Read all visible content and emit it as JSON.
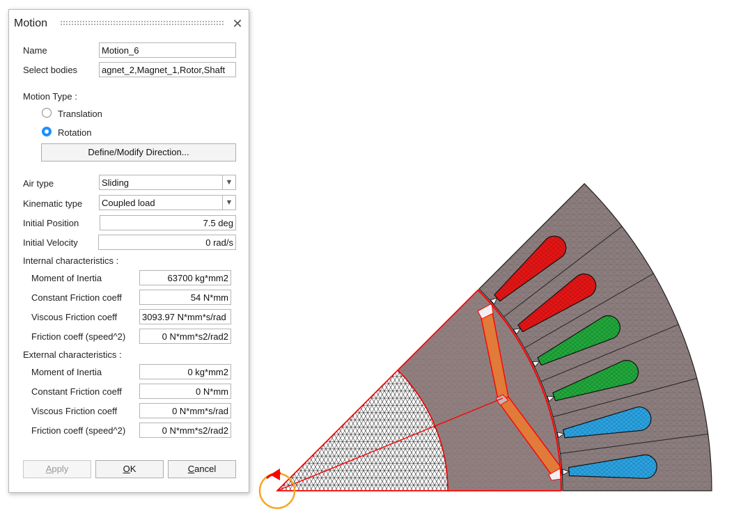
{
  "dialog": {
    "title": "Motion",
    "close_glyph": "✕",
    "name_label": "Name",
    "name_value": "Motion_6",
    "bodies_label": "Select bodies",
    "bodies_value": "agnet_2,Magnet_1,Rotor,Shaft",
    "motion_type_label": "Motion Type :",
    "translation_label": "Translation",
    "rotation_label": "Rotation",
    "selected_motion": "Rotation",
    "define_direction_button": "Define/Modify Direction...",
    "air_type_label": "Air type",
    "air_type_value": "Sliding",
    "kinematic_type_label": "Kinematic type",
    "kinematic_type_value": "Coupled load",
    "initial_position_label": "Initial Position",
    "initial_position_value": "7.5 deg",
    "initial_velocity_label": "Initial Velocity",
    "initial_velocity_value": "0 rad/s",
    "internal_header": "Internal characteristics :",
    "internal": {
      "moi_label": "Moment of Inertia",
      "moi_value": "63700 kg*mm2",
      "cf_label": "Constant Friction coeff",
      "cf_value": "54 N*mm",
      "vf_label": "Viscous Friction coeff",
      "vf_value": "3093.97 N*mm*s/rad",
      "f2_label": "Friction coeff (speed^2)",
      "f2_value": "0 N*mm*s2/rad2"
    },
    "external_header": "External characteristics :",
    "external": {
      "moi_label": "Moment of Inertia",
      "moi_value": "0 kg*mm2",
      "cf_label": "Constant Friction coeff",
      "cf_value": "0 N*mm",
      "vf_label": "Viscous Friction coeff",
      "vf_value": "0 N*mm*s/rad",
      "f2_label": "Friction coeff (speed^2)",
      "f2_value": "0 N*mm*s2/rad2"
    },
    "apply_mnemonic": "A",
    "apply_rest": "pply",
    "ok_mnemonic": "O",
    "ok_rest": "K",
    "cancel_mnemonic": "C",
    "cancel_rest": "ancel"
  },
  "viewport": {
    "mesh_color": "#917f7f",
    "stator_color": "#8c7e7e",
    "magnet_color": "#e07b39",
    "boundary_color": "#ff0000",
    "coil_colors": [
      "#29a3e3",
      "#29a3e3",
      "#1fa83a",
      "#1fa83a",
      "#e81313",
      "#e81313"
    ],
    "rotation_indicator": "rotation-arrow-icon"
  }
}
